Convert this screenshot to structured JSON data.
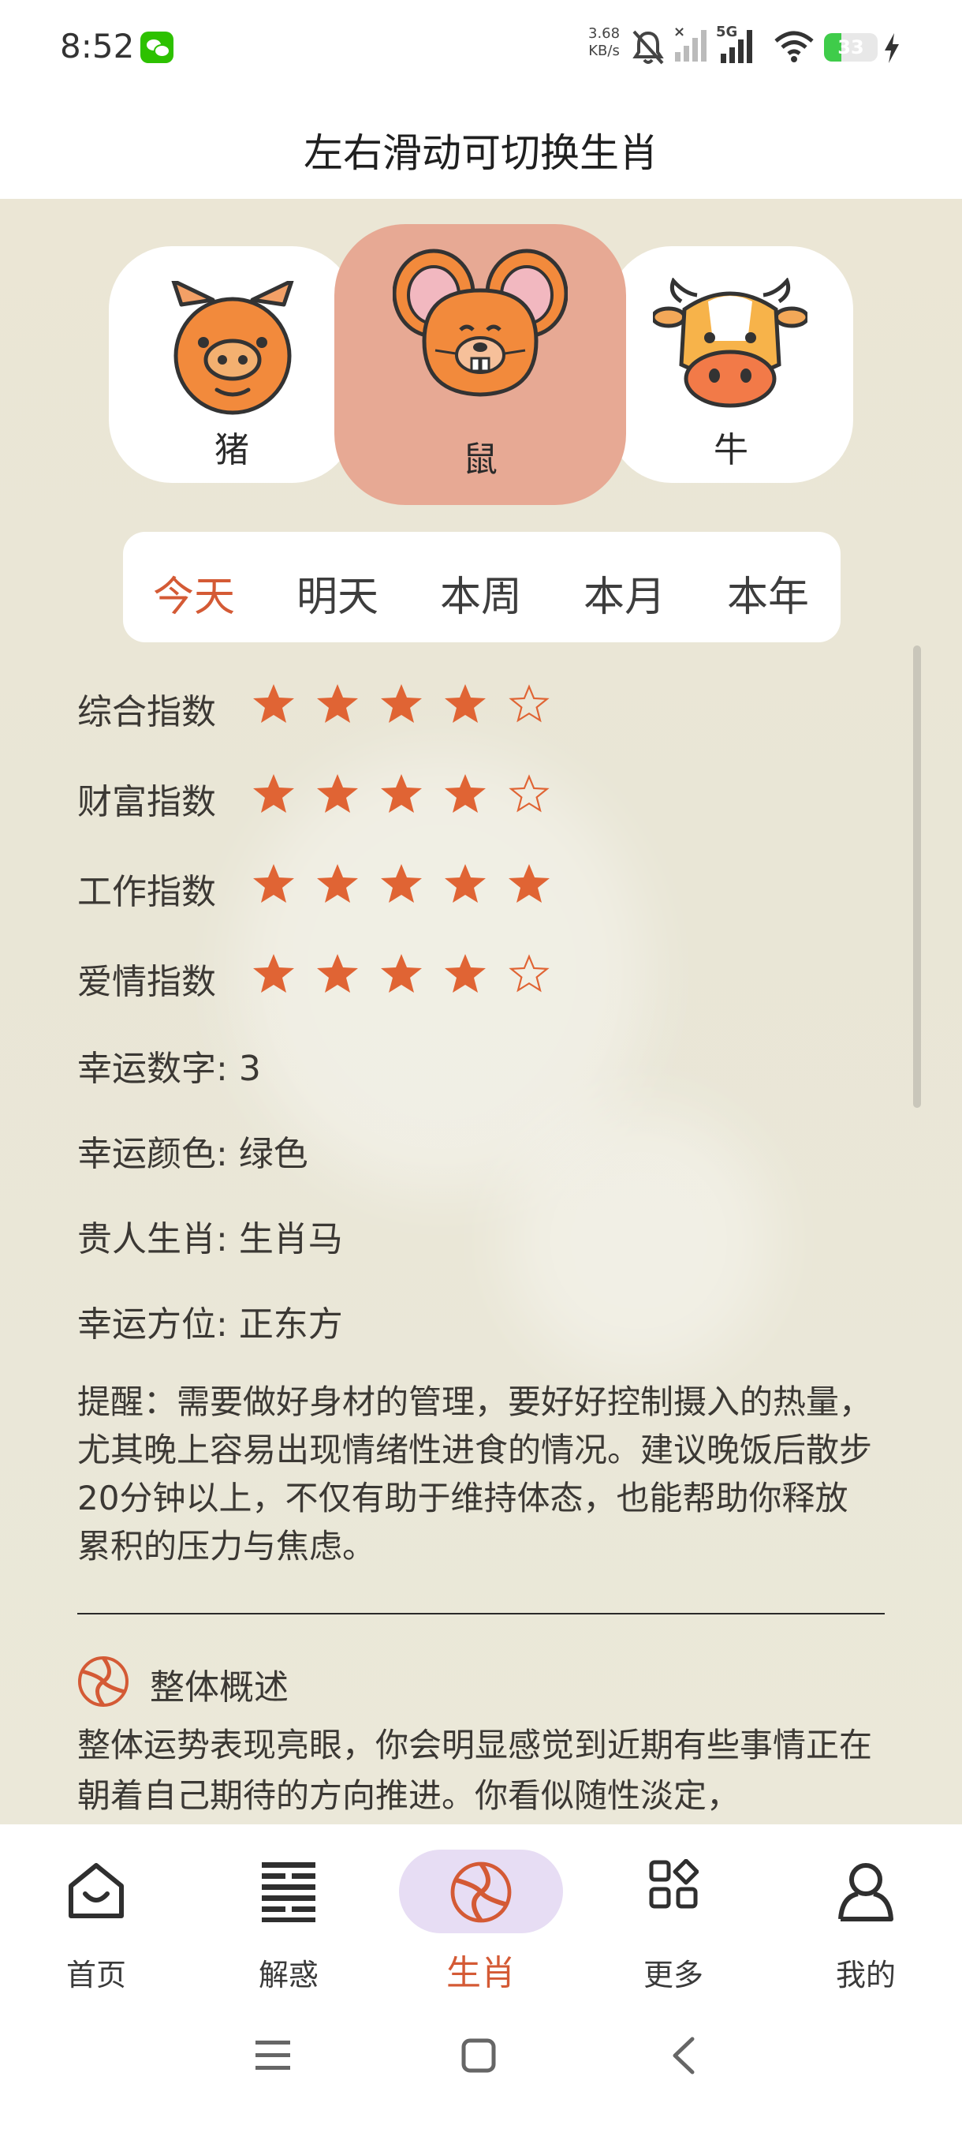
{
  "status_bar": {
    "time": "8:52",
    "net_speed_value": "3.68",
    "net_speed_unit": "KB/s",
    "network": "5G",
    "battery": "33",
    "battery_level": 0.33,
    "icons": [
      "wechat-icon",
      "mute-bell-icon",
      "signal-off-icon",
      "signal-5g-icon",
      "wifi-icon",
      "battery-icon",
      "charging-icon"
    ]
  },
  "header": {
    "title": "左右滑动可切换生肖"
  },
  "zodiac": [
    {
      "name": "猪",
      "icon": "pig-icon",
      "active": false
    },
    {
      "name": "鼠",
      "icon": "rat-icon",
      "active": true
    },
    {
      "name": "牛",
      "icon": "ox-icon",
      "active": false
    }
  ],
  "period_tabs": [
    {
      "label": "今天",
      "active": true
    },
    {
      "label": "明天",
      "active": false
    },
    {
      "label": "本周",
      "active": false
    },
    {
      "label": "本月",
      "active": false
    },
    {
      "label": "本年",
      "active": false
    }
  ],
  "ratings": [
    {
      "label": "综合指数",
      "stars": 4,
      "max": 5
    },
    {
      "label": "财富指数",
      "stars": 4,
      "max": 5
    },
    {
      "label": "工作指数",
      "stars": 5,
      "max": 5
    },
    {
      "label": "爱情指数",
      "stars": 4,
      "max": 5
    }
  ],
  "info": [
    {
      "label": "幸运数字",
      "value": "3"
    },
    {
      "label": "幸运颜色",
      "value": "绿色"
    },
    {
      "label": "贵人生肖",
      "value": "生肖马"
    },
    {
      "label": "幸运方位",
      "value": "正东方"
    }
  ],
  "reminder": "提醒：需要做好身材的管理，要好好控制摄入的热量，尤其晚上容易出现情绪性进食的情况。建议晚饭后散步20分钟以上，不仅有助于维持体态，也能帮助你释放累积的压力与焦虑。",
  "overview": {
    "title": "整体概述",
    "body": "整体运势表现亮眼，你会明显感觉到近期有些事情正在朝着自己期待的方向推进。你看似随性淡定，"
  },
  "bottom_nav": [
    {
      "label": "首页",
      "icon": "home-icon",
      "active": false
    },
    {
      "label": "解惑",
      "icon": "hexagram-icon",
      "active": false
    },
    {
      "label": "生肖",
      "icon": "zodiac-swirl-icon",
      "active": true
    },
    {
      "label": "更多",
      "icon": "grid-icon",
      "active": false
    },
    {
      "label": "我的",
      "icon": "user-icon",
      "active": false
    }
  ],
  "colors": {
    "accent": "#d45a35",
    "star": "#e06434",
    "active_card": "#e7a994",
    "nav_pill": "#e7ddf4",
    "page_bg": "#ebe6d5"
  }
}
